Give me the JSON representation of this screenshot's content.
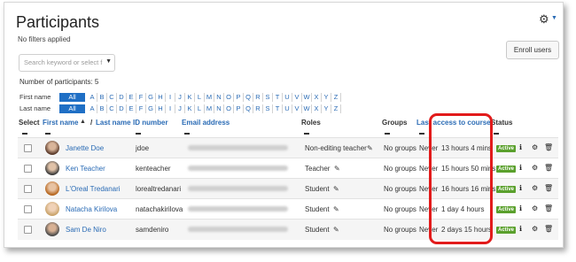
{
  "header": {
    "title": "Participants",
    "filters_text": "No filters applied",
    "enroll_button": "Enroll users"
  },
  "search": {
    "placeholder": "Search keyword or select f"
  },
  "summary": {
    "count_text": "Number of participants: 5"
  },
  "initials": {
    "first_label": "First name",
    "last_label": "Last name",
    "all_label": "All",
    "letters": [
      "A",
      "B",
      "C",
      "D",
      "E",
      "F",
      "G",
      "H",
      "I",
      "J",
      "K",
      "L",
      "M",
      "N",
      "O",
      "P",
      "Q",
      "R",
      "S",
      "T",
      "U",
      "V",
      "W",
      "X",
      "Y",
      "Z"
    ]
  },
  "table": {
    "headers": {
      "select": "Select",
      "first_name": "First name",
      "sort_arrow": "▲",
      "slash": "/",
      "last_name": "Last name",
      "id_number": "ID number",
      "email": "Email address",
      "roles": "Roles",
      "groups": "Groups",
      "last_access": "Last access to course",
      "status": "Status"
    },
    "rows": [
      {
        "name": "Janette Doe",
        "id": "jdoe",
        "role": "Non-editing teacher",
        "groups": "No groups",
        "never": "Never",
        "last_access": "13 hours 4 mins",
        "status": "Active"
      },
      {
        "name": "Ken Teacher",
        "id": "kenteacher",
        "role": "Teacher",
        "groups": "No groups",
        "never": "Never",
        "last_access": "15 hours 50 mins",
        "status": "Active"
      },
      {
        "name": "L'Oreal Tredanari",
        "id": "lorealtredanari",
        "role": "Student",
        "groups": "No groups",
        "never": "Never",
        "last_access": "16 hours 16 mins",
        "status": "Active"
      },
      {
        "name": "Natacha Kirilova",
        "id": "natachakirilova",
        "role": "Student",
        "groups": "No groups",
        "never": "Never",
        "last_access": "1 day 4 hours",
        "status": "Active"
      },
      {
        "name": "Sam De Niro",
        "id": "samdeniro",
        "role": "Student",
        "groups": "No groups",
        "never": "Never",
        "last_access": "2 days 15 hours",
        "status": "Active"
      }
    ]
  },
  "colors": {
    "link": "#2a6bb5",
    "active_badge": "#5aa02c",
    "highlight": "#e21b1b",
    "all_button": "#1f6fc5"
  },
  "icons": {
    "settings": "gear-icon",
    "edit_role": "pencil-icon",
    "info": "info-icon",
    "manage": "gear-icon",
    "delete": "trash-icon"
  }
}
